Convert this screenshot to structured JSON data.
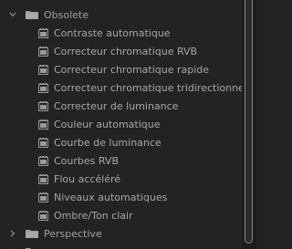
{
  "tree": {
    "group_open": {
      "label": "Obsolete",
      "expanded": true
    },
    "items": [
      {
        "label": "Contraste automatique"
      },
      {
        "label": "Correcteur chromatique RVB"
      },
      {
        "label": "Correcteur chromatique rapide"
      },
      {
        "label": "Correcteur chromatique tridirectionnel"
      },
      {
        "label": "Correcteur de luminance"
      },
      {
        "label": "Couleur automatique"
      },
      {
        "label": "Courbe de luminance"
      },
      {
        "label": "Courbes RVB"
      },
      {
        "label": "Flou accéléré"
      },
      {
        "label": "Niveaux automatiques"
      },
      {
        "label": "Ombre/Ton clair"
      }
    ],
    "group_closed": {
      "label": "Perspective",
      "expanded": false
    }
  }
}
